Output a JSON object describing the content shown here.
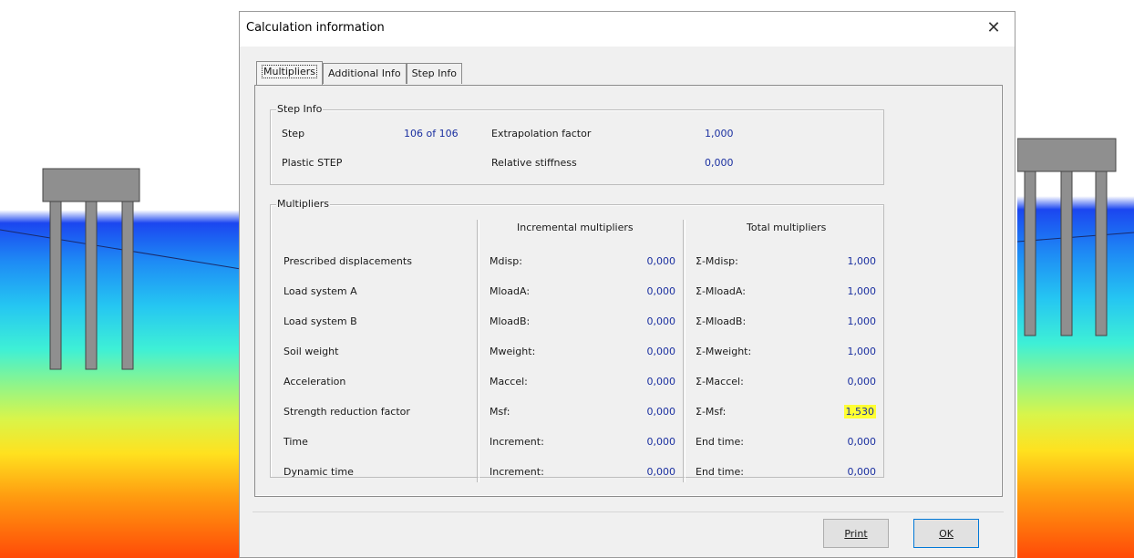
{
  "dialog": {
    "title": "Calculation information",
    "close_glyph": "✕",
    "tabs": [
      "Multipliers",
      "Additional Info",
      "Step Info"
    ],
    "active_tab": "Multipliers"
  },
  "step_info": {
    "legend": "Step Info",
    "step_label": "Step",
    "step_value": "106 of 106",
    "plastic_label": "Plastic STEP",
    "extrapolation_label": "Extrapolation factor",
    "extrapolation_value": "1,000",
    "relative_stiffness_label": "Relative stiffness",
    "relative_stiffness_value": "0,000"
  },
  "multipliers": {
    "legend": "Multipliers",
    "incremental_header": "Incremental multipliers",
    "total_header": "Total multipliers",
    "rows": [
      {
        "label": "Prescribed displacements",
        "inc_name": "Mdisp:",
        "inc_value": "0,000",
        "tot_name": "Σ-Mdisp:",
        "tot_value": "1,000"
      },
      {
        "label": "Load system A",
        "inc_name": "MloadA:",
        "inc_value": "0,000",
        "tot_name": "Σ-MloadA:",
        "tot_value": "1,000"
      },
      {
        "label": "Load system B",
        "inc_name": "MloadB:",
        "inc_value": "0,000",
        "tot_name": "Σ-MloadB:",
        "tot_value": "1,000"
      },
      {
        "label": "Soil weight",
        "inc_name": "Mweight:",
        "inc_value": "0,000",
        "tot_name": "Σ-Mweight:",
        "tot_value": "1,000"
      },
      {
        "label": "Acceleration",
        "inc_name": "Maccel:",
        "inc_value": "0,000",
        "tot_name": "Σ-Maccel:",
        "tot_value": "0,000"
      },
      {
        "label": "Strength reduction factor",
        "inc_name": "Msf:",
        "inc_value": "0,000",
        "tot_name": "Σ-Msf:",
        "tot_value": "1,530"
      },
      {
        "label": "Time",
        "inc_name": "Increment:",
        "inc_value": "0,000",
        "tot_name": "End time:",
        "tot_value": "0,000"
      },
      {
        "label": "Dynamic time",
        "inc_name": "Increment:",
        "inc_value": "0,000",
        "tot_name": "End time:",
        "tot_value": "0,000"
      }
    ],
    "highlight_color": "#ffff33"
  },
  "buttons": {
    "print_label": "Print",
    "ok_label": "OK"
  },
  "colors": {
    "value_text": "#1a2fa0",
    "dialog_bg": "#f0f0f0"
  }
}
